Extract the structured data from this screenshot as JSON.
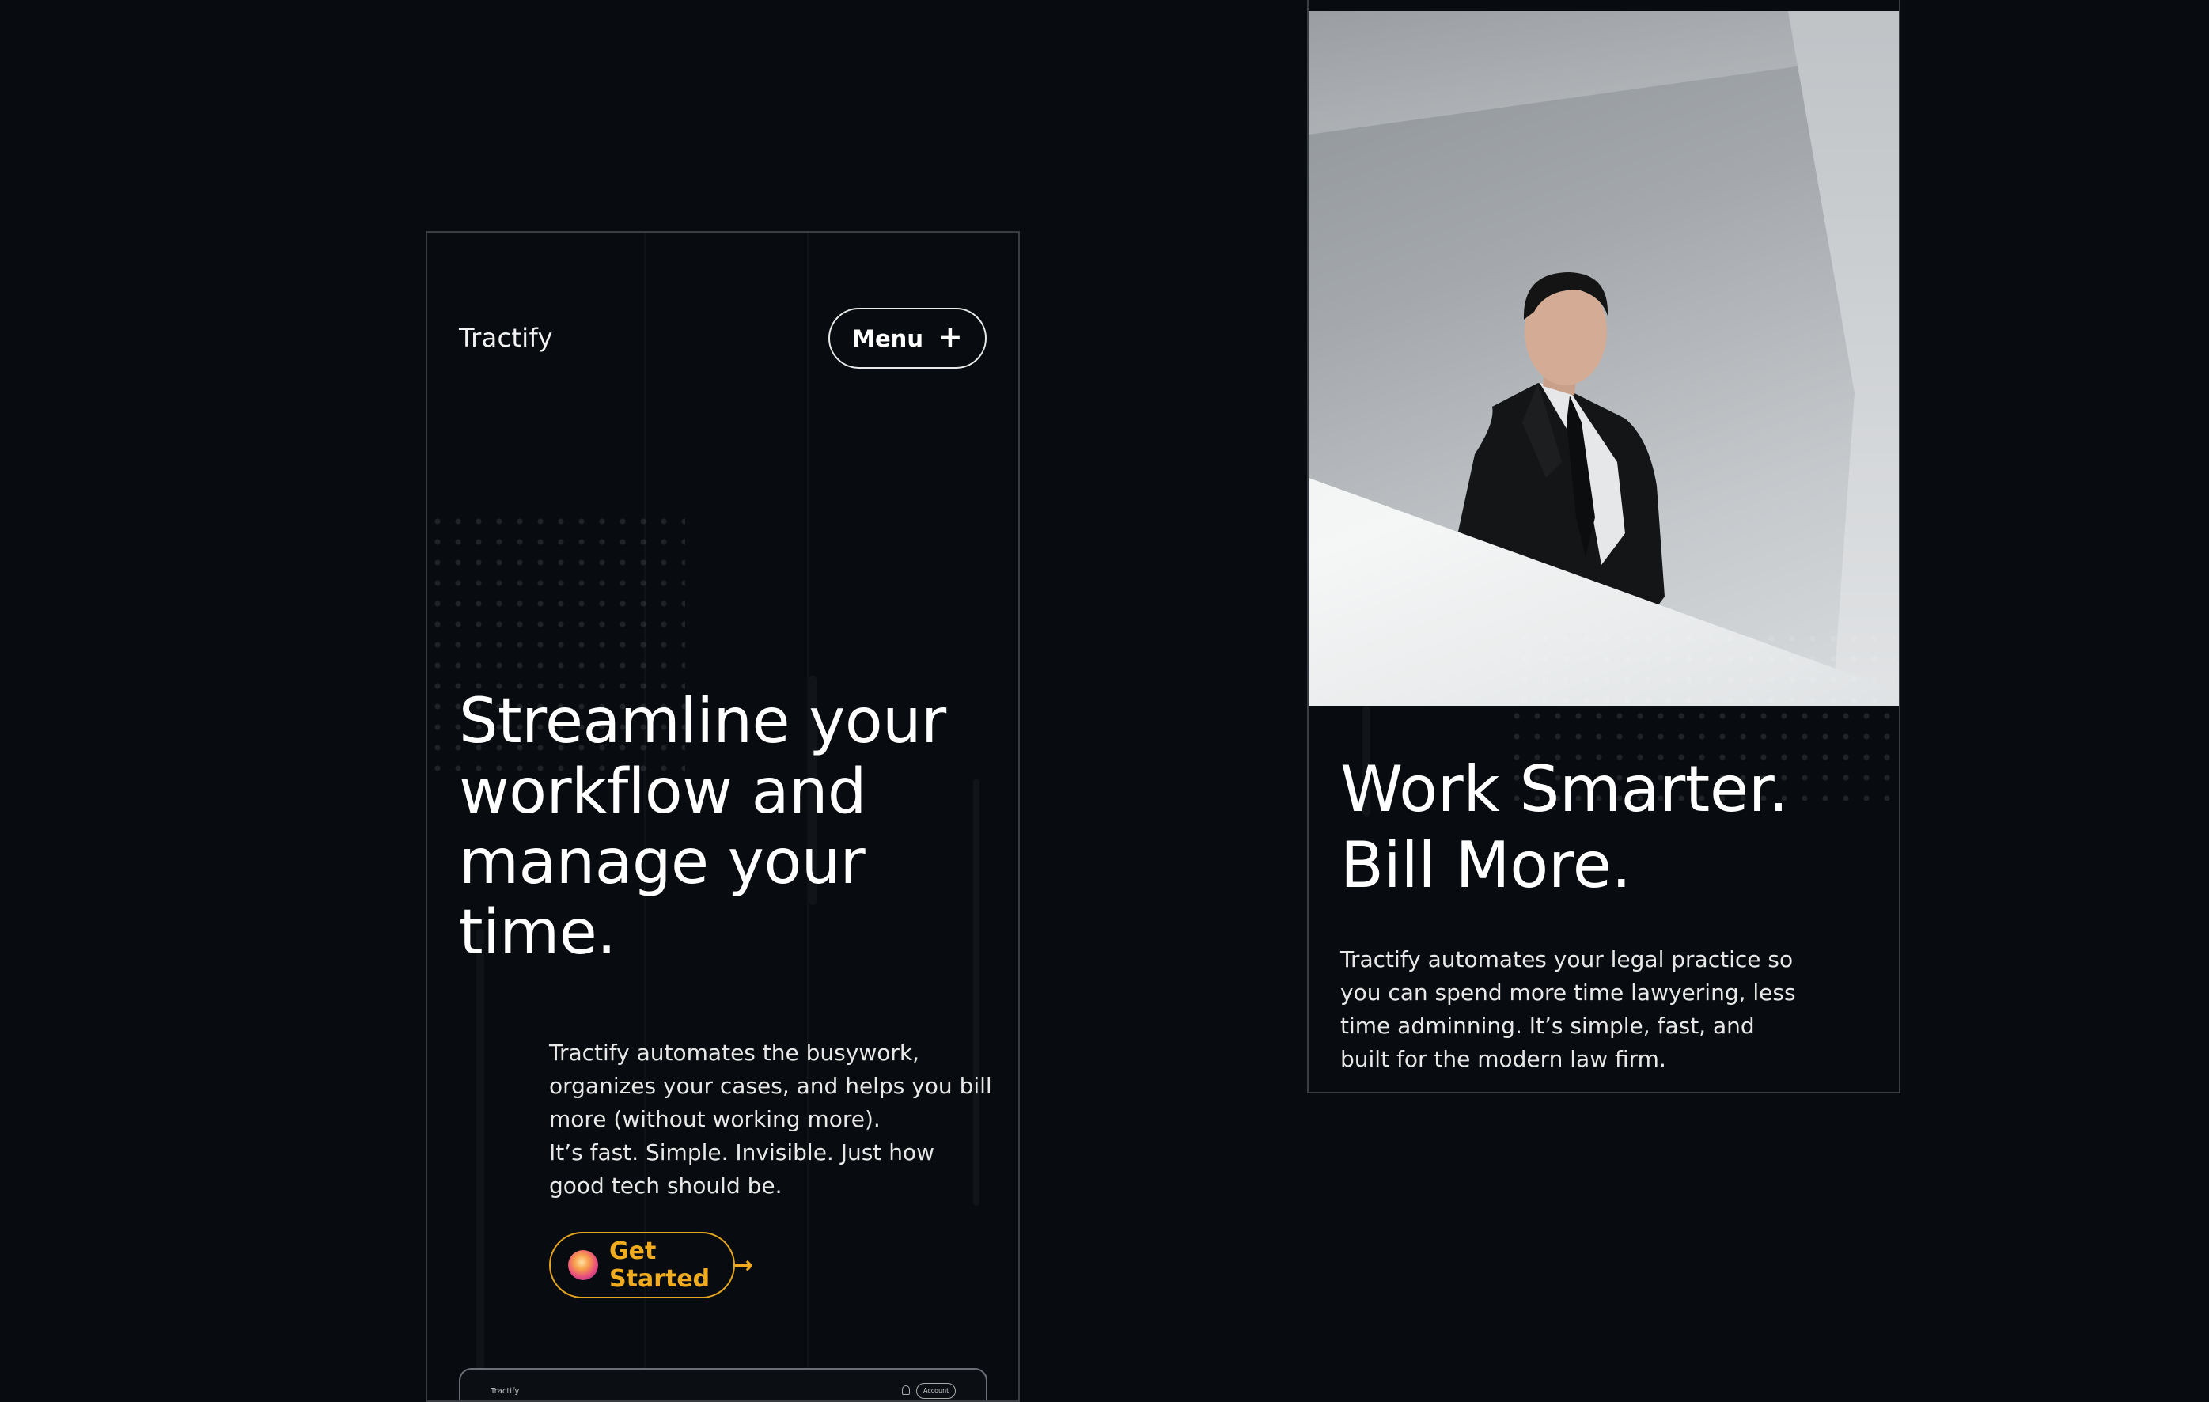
{
  "left_screen": {
    "brand": "Tractify",
    "menu": {
      "label": "Menu",
      "icon": "plus-icon"
    },
    "hero": {
      "title": "Streamline your workflow and manage your time.",
      "body_line1": "Tractify automates the busywork, organizes your cases, and helps you bill more (without working more).",
      "body_line2": "It’s fast. Simple. Invisible. Just how good tech should be."
    },
    "cta": {
      "label": "Get Started",
      "icon": "arrow-right-icon",
      "accent": "#F0AB1E"
    },
    "preview": {
      "brand": "Tractify",
      "account_label": "Account"
    }
  },
  "right_screen": {
    "title_line1": "Work Smarter.",
    "title_line2": "Bill More.",
    "body": "Tractify automates your legal practice so you can spend more time lawyering, less time adminning. It’s simple, fast, and built for the modern law firm."
  },
  "colors": {
    "background": "#080B0F",
    "border": "#3A3D42",
    "text": "#FFFFFF",
    "accent": "#F0AB1E"
  }
}
